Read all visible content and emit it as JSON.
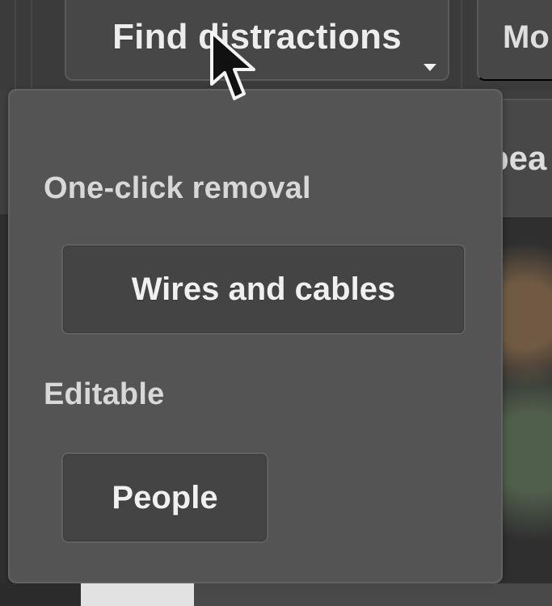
{
  "toolbar": {
    "find_button_label": "Find distractions",
    "more_button_label": "Mo",
    "side_strip_text": "pea"
  },
  "popup": {
    "one_click_title": "One-click removal",
    "wires_button_label": "Wires and cables",
    "editable_title": "Editable",
    "people_button_label": "People"
  },
  "icons": {
    "dropdown": "chevron-down-icon",
    "cursor": "mouse-cursor-icon"
  }
}
